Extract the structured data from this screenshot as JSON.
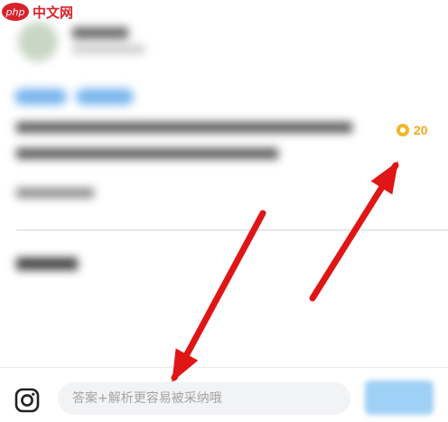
{
  "watermark": {
    "logo": "php",
    "text": "中文网"
  },
  "question": {
    "reward": {
      "icon": "coin-icon",
      "value": "20",
      "color": "#f0a81c"
    }
  },
  "answer_bar": {
    "camera_icon": "camera-icon",
    "input_placeholder": "答案+解析更容易被采纳哦",
    "input_value": ""
  },
  "annotation": {
    "arrow_color": "#e01515",
    "arrow_count": 2
  }
}
